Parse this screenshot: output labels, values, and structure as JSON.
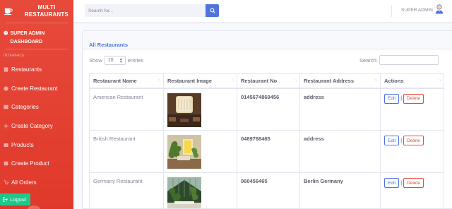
{
  "sidebar": {
    "brand": "MULTI RESTAURANTS",
    "brand_icon": "coffee-cup-icon",
    "dashboard_label": "SUPER ADMIN DASHBOARD",
    "section_heading": "INTERFACE",
    "items": [
      {
        "label": "Restaurants",
        "icon": "list-icon"
      },
      {
        "label": "Create Restaurant",
        "icon": "plus-circle-icon"
      },
      {
        "label": "Categories",
        "icon": "grid-icon"
      },
      {
        "label": "Create Category",
        "icon": "plus-icon"
      },
      {
        "label": "Products",
        "icon": "box-icon"
      },
      {
        "label": "Create Product",
        "icon": "square-icon"
      },
      {
        "label": "All Orders",
        "icon": "cart-icon"
      }
    ],
    "logout_label": "Logout"
  },
  "topbar": {
    "search_placeholder": "Search for...",
    "user_name": "SUPER ADMIN"
  },
  "card": {
    "title": "All Restaurants",
    "show_label": "Show",
    "entries_value": "10",
    "entries_label": "entries",
    "search_label": "Search:"
  },
  "table": {
    "headers": [
      "Restaurant Name",
      "Restaurant Image",
      "Restaurant No",
      "Restaurant Address",
      "Actions"
    ],
    "rows": [
      {
        "name": "American Restaurant",
        "number": "0145674869456",
        "address": "address",
        "image": "chandelier-dining-room"
      },
      {
        "name": "British Restaurant",
        "number": "0489768465",
        "address": "address",
        "image": "plant-cafe-interior"
      },
      {
        "name": "Germany Restaurant",
        "number": "060456465",
        "address": "Berlin Germany",
        "image": "greenhouse-dining"
      }
    ],
    "edit_label": "Edit",
    "delete_label": "Delete",
    "separator": "|"
  },
  "colors": {
    "sidebar": "#e74a3b",
    "primary": "#4e73df",
    "success": "#1cc88a",
    "danger": "#e74a3b"
  }
}
